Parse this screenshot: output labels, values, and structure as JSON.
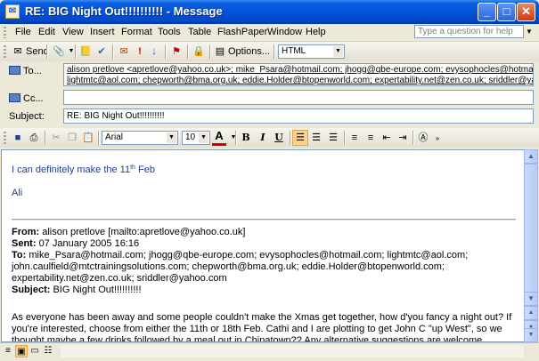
{
  "window": {
    "title": "RE: BIG Night Out!!!!!!!!!! - Message",
    "minimize_glyph": "_",
    "maximize_glyph": "□",
    "close_glyph": "✕"
  },
  "menu": {
    "items": [
      "File",
      "Edit",
      "View",
      "Insert",
      "Format",
      "Tools",
      "Table",
      "FlashPaper",
      "Window",
      "Help"
    ],
    "help_placeholder": "Type a question for help"
  },
  "toolbar1": {
    "send_label": "Send",
    "options_label": "Options...",
    "format_value": "HTML"
  },
  "header": {
    "to_label": "To...",
    "cc_label": "Cc...",
    "subject_label": "Subject:",
    "to_line1": "alison pretlove <apretlove@yahoo.co.uk>; mike_Psara@hotmail.com; jhogg@qbe-europe.com; evysophocles@hotmail.com;",
    "to_line2": "lightmtc@aol.com; chepworth@bma.org.uk; eddie.Holder@btopenworld.com; expertability.net@zen.co.uk; sriddler@yahoo.com",
    "cc_value": "",
    "subject_value": "RE: BIG Night Out!!!!!!!!!!"
  },
  "toolbar2": {
    "font": "Arial",
    "size": "10",
    "bold": "B",
    "italic": "I",
    "underline": "U"
  },
  "message": {
    "reply_pre": "I can definitely make the 11",
    "reply_sup": "th",
    "reply_post": " Feb",
    "signature": "Ali",
    "from_label": "From:",
    "from_value": "alison pretlove [mailto:apretlove@yahoo.co.uk]",
    "sent_label": "Sent:",
    "sent_value": "07 January 2005 16:16",
    "to_label": "To:",
    "to_line1": "mike_Psara@hotmail.com; jhogg@qbe-europe.com; evysophocles@hotmail.com; lightmtc@aol.com;",
    "to_line2": "john.caulfield@mtctrainingsolutions.com; chepworth@bma.org.uk; eddie.Holder@btopenworld.com;",
    "to_line3": "expertability.net@zen.co.uk; sriddler@yahoo.com",
    "subject_label": "Subject:",
    "subject_value": "BIG Night Out!!!!!!!!!!",
    "para1_line1": "As everyone has been away and some people couldn't make the Xmas get together, how d'you fancy a night out?  If",
    "para1_line2": "you're interested, choose from either the 11th or 18th Feb.  Cathi and I are plotting to get John C \"up West\", so we",
    "para1_line3": "thought maybe a few drinks followed by a meal out in Chinatown??  Any alternative suggestions are welcome"
  },
  "colors": {
    "titlebar": "#0354d8",
    "reply_text": "#1f3d8f",
    "chrome": "#ece9d8"
  }
}
